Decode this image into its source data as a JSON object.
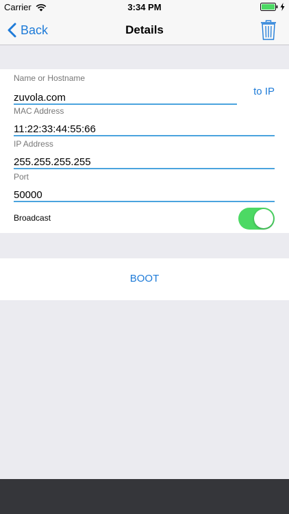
{
  "status_bar": {
    "carrier": "Carrier",
    "time": "3:34 PM",
    "battery_color": "#4cd964"
  },
  "nav": {
    "back_label": "Back",
    "title": "Details"
  },
  "form": {
    "hostname": {
      "label": "Name or Hostname",
      "value": "zuvola.com"
    },
    "to_ip_label": "to IP",
    "mac": {
      "label": "MAC Address",
      "value": "11:22:33:44:55:66"
    },
    "ip": {
      "label": "IP Address",
      "value": "255.255.255.255"
    },
    "port": {
      "label": "Port",
      "value": "50000"
    },
    "broadcast": {
      "label": "Broadcast",
      "enabled": true
    }
  },
  "boot_label": "BOOT",
  "colors": {
    "accent": "#1e7bd8",
    "input_underline": "#4aa3de",
    "toggle_on": "#4cd964",
    "background": "#ebebf0",
    "bottom_bar": "#35363a"
  },
  "icons": [
    "wifi-icon",
    "battery-icon",
    "charging-bolt-icon",
    "chevron-left-icon",
    "trash-icon"
  ]
}
